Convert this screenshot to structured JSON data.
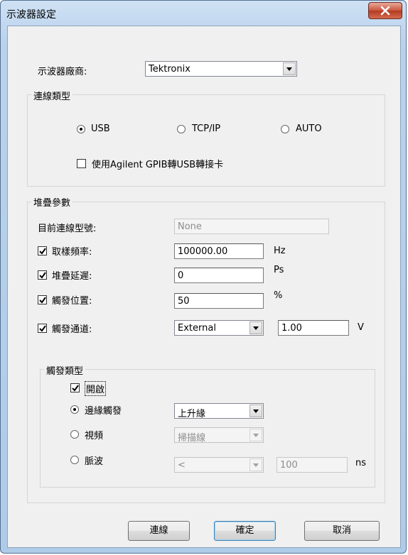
{
  "window": {
    "title": "示波器設定"
  },
  "vendor": {
    "label": "示波器廠商:",
    "value": "Tektronix"
  },
  "connection_type": {
    "title": "連線類型",
    "options": [
      "USB",
      "TCP/IP",
      "AUTO"
    ],
    "selected": "USB",
    "gpib_checkbox": {
      "label": "使用Agilent GPIB轉USB轉接卡",
      "checked": false
    }
  },
  "stack_params": {
    "title": "堆疊參數",
    "model": {
      "label": "目前連線型號:",
      "value": "None"
    },
    "sample_rate": {
      "label": "取樣頻率:",
      "value": "100000.00",
      "unit": "Hz",
      "checked": true
    },
    "stack_delay": {
      "label": "堆疊延遲:",
      "value": "0",
      "unit": "Ps",
      "checked": true
    },
    "trigger_position": {
      "label": "觸發位置:",
      "value": "50",
      "unit": "%",
      "checked": true
    },
    "trigger_channel": {
      "label": "觸發通道:",
      "channel": "External",
      "level": "1.00",
      "unit": "V",
      "checked": true
    }
  },
  "trigger_type": {
    "title": "觸發類型",
    "enable": {
      "label": "開啟",
      "checked": true
    },
    "edge": {
      "label": "邊緣觸發",
      "value": "上升緣",
      "selected": true
    },
    "video": {
      "label": "視頻",
      "value": "掃描線",
      "selected": false
    },
    "pulse": {
      "label": "脈波",
      "op": "<",
      "value": "100",
      "unit": "ns",
      "selected": false
    }
  },
  "buttons": {
    "connect": "連線",
    "ok": "確定",
    "cancel": "取消"
  }
}
